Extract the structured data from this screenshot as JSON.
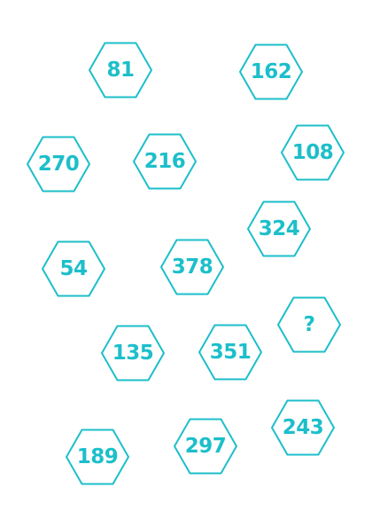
{
  "colors": {
    "accent": "#1cbfca",
    "background": "#ffffff"
  },
  "puzzle": {
    "hexagons": [
      {
        "label": "81"
      },
      {
        "label": "162"
      },
      {
        "label": "270"
      },
      {
        "label": "216"
      },
      {
        "label": "108"
      },
      {
        "label": "324"
      },
      {
        "label": "54"
      },
      {
        "label": "378"
      },
      {
        "label": "?"
      },
      {
        "label": "135"
      },
      {
        "label": "351"
      },
      {
        "label": "243"
      },
      {
        "label": "189"
      },
      {
        "label": "297"
      }
    ]
  }
}
